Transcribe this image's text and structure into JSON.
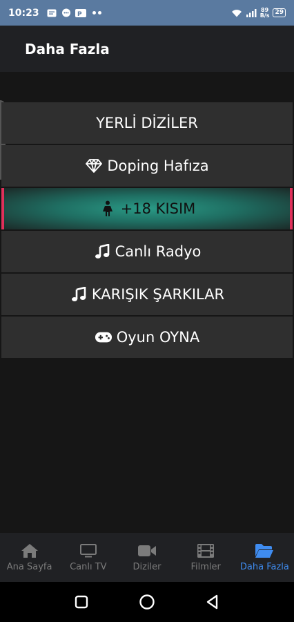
{
  "status_bar": {
    "time": "10:23",
    "speed_top": "89",
    "speed_bottom": "B/s",
    "battery": "29"
  },
  "header": {
    "title": "Daha Fazla"
  },
  "menu": {
    "items": [
      {
        "label": "YERLİ DİZİLER",
        "icon": "none"
      },
      {
        "label": "Doping Hafıza",
        "icon": "diamond-icon"
      },
      {
        "label": "+18 KISIM",
        "icon": "female-icon"
      },
      {
        "label": "Canlı Radyo",
        "icon": "music-icon"
      },
      {
        "label": "KARIŞIK ŞARKILAR",
        "icon": "music-icon"
      },
      {
        "label": "Oyun OYNA",
        "icon": "gamepad-icon"
      }
    ],
    "active_index": 2
  },
  "bottom_nav": {
    "items": [
      {
        "label": "Ana Sayfa",
        "icon": "home-icon"
      },
      {
        "label": "Canlı TV",
        "icon": "tv-icon"
      },
      {
        "label": "Diziler",
        "icon": "video-camera-icon"
      },
      {
        "label": "Filmler",
        "icon": "film-icon"
      },
      {
        "label": "Daha Fazla",
        "icon": "folder-open-icon"
      }
    ],
    "active_index": 4
  },
  "colors": {
    "accent": "#3f8cf0",
    "active_item_border": "#e0305a",
    "active_item_fill": "#2a9a86"
  }
}
